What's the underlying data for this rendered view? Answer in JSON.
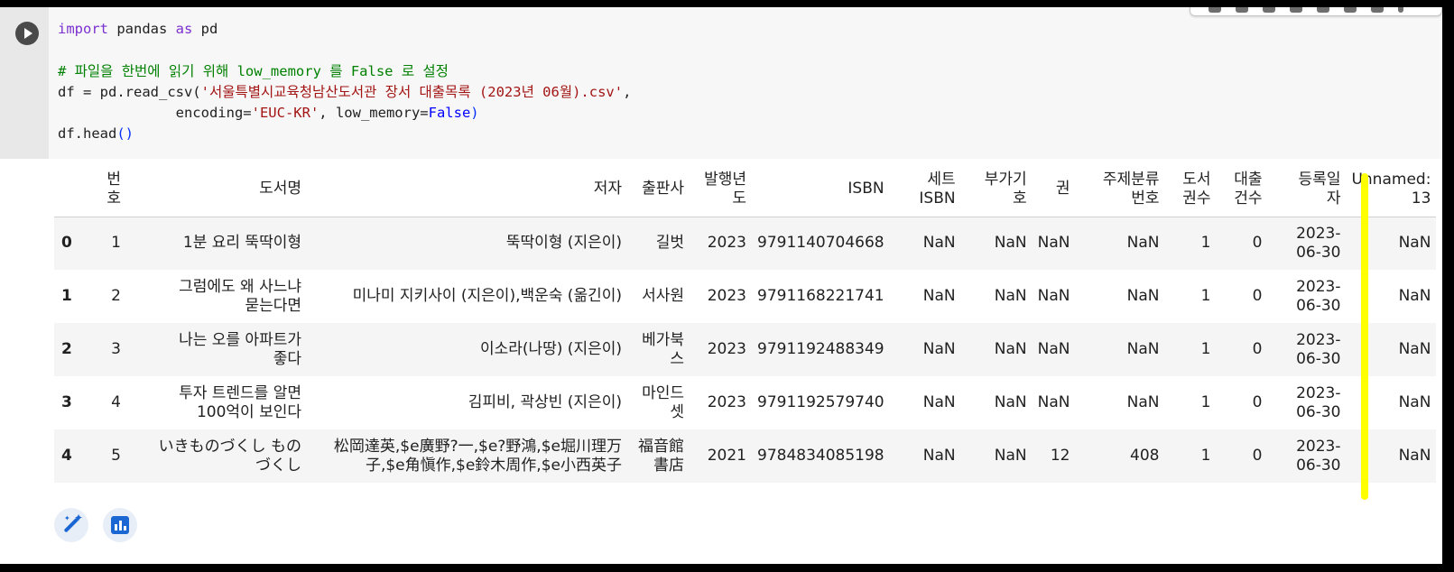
{
  "code": {
    "line1": {
      "kw1": "import",
      "mid": " pandas ",
      "kw2": "as",
      "end": " pd"
    },
    "line3": "# 파일을 한번에 읽기 위해 low_memory 를 False 로 설정",
    "line4": {
      "prefix": "df = pd.read_csv(",
      "str": "'서울특별시교육청남산도서관 장서 대출목록 (2023년 06월).csv'",
      "suffix": ","
    },
    "line5": {
      "indent": "              encoding=",
      "str": "'EUC-KR'",
      "mid": ", low_memory=",
      "bool": "False",
      "close": ")"
    },
    "line6": {
      "prefix": "df.head",
      "parens": "()"
    }
  },
  "table": {
    "columns": [
      "번\n호",
      "도서명",
      "저자",
      "출판사",
      "발행년\n도",
      "ISBN",
      "세트\nISBN",
      "부가기\n호",
      "권",
      "주제분류\n번호",
      "도서\n권수",
      "대출\n건수",
      "등록일\n자",
      "Unnamed:\n13"
    ],
    "rows": [
      {
        "index": "0",
        "cells": [
          "1",
          "1분 요리 뚝딱이형",
          "뚝딱이형 (지은이)",
          "길벗",
          "2023",
          "9791140704668",
          "NaN",
          "NaN",
          "NaN",
          "NaN",
          "1",
          "0",
          "2023-\n06-30",
          "NaN"
        ]
      },
      {
        "index": "1",
        "cells": [
          "2",
          "그럼에도 왜 사느냐\n묻는다면",
          "미나미 지키사이 (지은이),백운숙 (옮긴이)",
          "서사원",
          "2023",
          "9791168221741",
          "NaN",
          "NaN",
          "NaN",
          "NaN",
          "1",
          "0",
          "2023-\n06-30",
          "NaN"
        ]
      },
      {
        "index": "2",
        "cells": [
          "3",
          "나는 오를 아파트가\n좋다",
          "이소라(나땅) (지은이)",
          "베가북\n스",
          "2023",
          "9791192488349",
          "NaN",
          "NaN",
          "NaN",
          "NaN",
          "1",
          "0",
          "2023-\n06-30",
          "NaN"
        ]
      },
      {
        "index": "3",
        "cells": [
          "4",
          "투자 트렌드를 알면\n100억이 보인다",
          "김피비, 곽상빈 (지은이)",
          "마인드\n셋",
          "2023",
          "9791192579740",
          "NaN",
          "NaN",
          "NaN",
          "NaN",
          "1",
          "0",
          "2023-\n06-30",
          "NaN"
        ]
      },
      {
        "index": "4",
        "cells": [
          "5",
          "いきものづくし もの\nづくし",
          "松岡達英,$e廣野?一,$e?野鴻,$e堀川理万\n子,$e角愼作,$e鈴木周作,$e小西英子",
          "福音館\n書店",
          "2021",
          "9784834085198",
          "NaN",
          "NaN",
          "12",
          "408",
          "1",
          "0",
          "2023-\n06-30",
          "NaN"
        ]
      }
    ]
  },
  "colors": {
    "highlight": "#ffff00",
    "accent": "#1a66d2"
  },
  "icons": {
    "run": "play-icon",
    "magic": "magic-wand-icon",
    "chart": "bar-chart-icon"
  }
}
